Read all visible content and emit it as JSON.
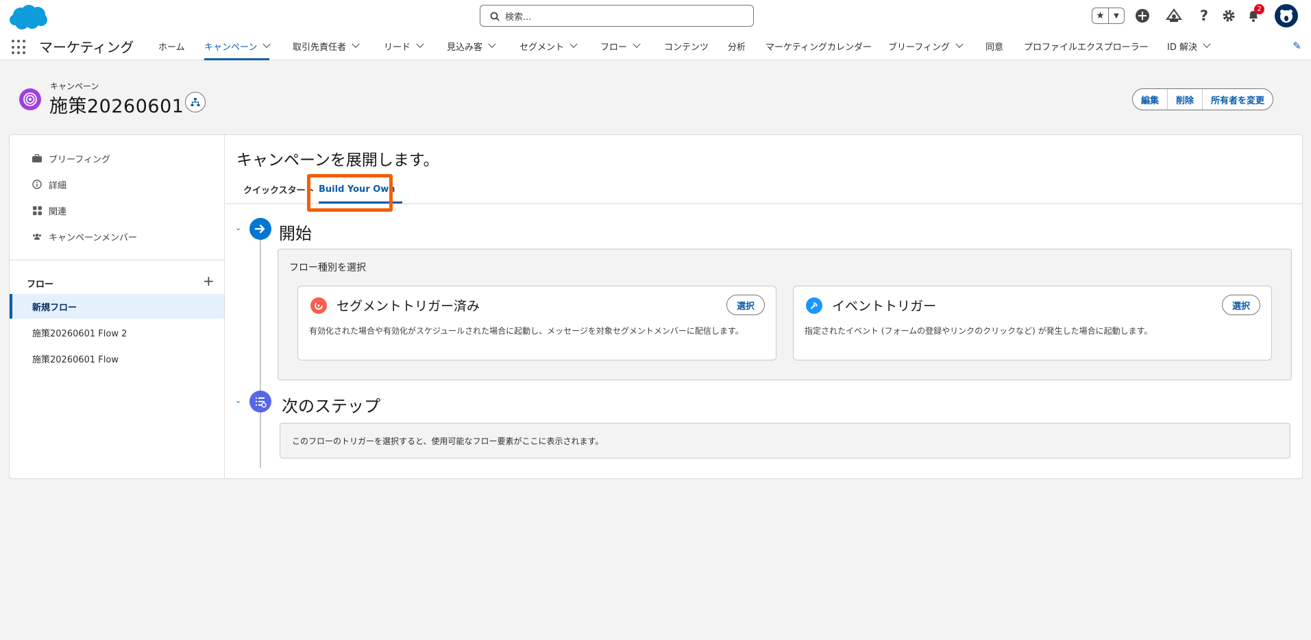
{
  "header": {
    "search_placeholder": "検索...",
    "notification_count": "2"
  },
  "nav": {
    "app_name": "マーケティング",
    "items": [
      {
        "label": "ホーム",
        "dropdown": false
      },
      {
        "label": "キャンペーン",
        "dropdown": true,
        "active": true
      },
      {
        "label": "取引先責任者",
        "dropdown": true
      },
      {
        "label": "リード",
        "dropdown": true
      },
      {
        "label": "見込み客",
        "dropdown": true
      },
      {
        "label": "セグメント",
        "dropdown": true
      },
      {
        "label": "フロー",
        "dropdown": true
      },
      {
        "label": "コンテンツ",
        "dropdown": false
      },
      {
        "label": "分析",
        "dropdown": false
      },
      {
        "label": "マーケティングカレンダー",
        "dropdown": false
      },
      {
        "label": "ブリーフィング",
        "dropdown": true
      },
      {
        "label": "同意",
        "dropdown": false
      },
      {
        "label": "プロファイルエクスプローラー",
        "dropdown": false
      },
      {
        "label": "ID 解決",
        "dropdown": true
      }
    ]
  },
  "record": {
    "type": "キャンペーン",
    "title": "施策20260601",
    "actions": [
      "編集",
      "削除",
      "所有者を変更"
    ]
  },
  "sidebar": {
    "items": [
      {
        "label": "ブリーフィング",
        "icon": "briefcase-icon"
      },
      {
        "label": "詳細",
        "icon": "info-icon"
      },
      {
        "label": "関連",
        "icon": "related-icon"
      },
      {
        "label": "キャンペーンメンバー",
        "icon": "members-icon"
      }
    ],
    "flow_header": "フロー",
    "flows": [
      {
        "label": "新規フロー",
        "selected": true
      },
      {
        "label": "施策20260601 Flow 2",
        "selected": false
      },
      {
        "label": "施策20260601 Flow",
        "selected": false
      }
    ]
  },
  "main": {
    "title": "キャンペーンを展開します。",
    "tabs": [
      {
        "label": "クイックスタート",
        "active": false
      },
      {
        "label": "Build Your Own",
        "active": true
      }
    ],
    "start": {
      "title": "開始",
      "select_label": "フロー種別を選択",
      "cards": [
        {
          "name": "セグメントトリガー済み",
          "button": "選択",
          "desc": "有効化された場合や有効化がスケジュールされた場合に起動し、メッセージを対象セグメントメンバーに配信します。",
          "color": "#fe5c4c"
        },
        {
          "name": "イベントトリガー",
          "button": "選択",
          "desc": "指定されたイベント (フォームの登録やリンクのクリックなど) が発生した場合に起動します。",
          "color": "#1b96ff"
        }
      ]
    },
    "next": {
      "title": "次のステップ",
      "message": "このフローのトリガーを選択すると、使用可能なフロー要素がここに表示されます。"
    }
  },
  "colors": {
    "brand": "#0b5cab",
    "highlight": "#f25f0a",
    "campaign": "#a13ee3"
  }
}
